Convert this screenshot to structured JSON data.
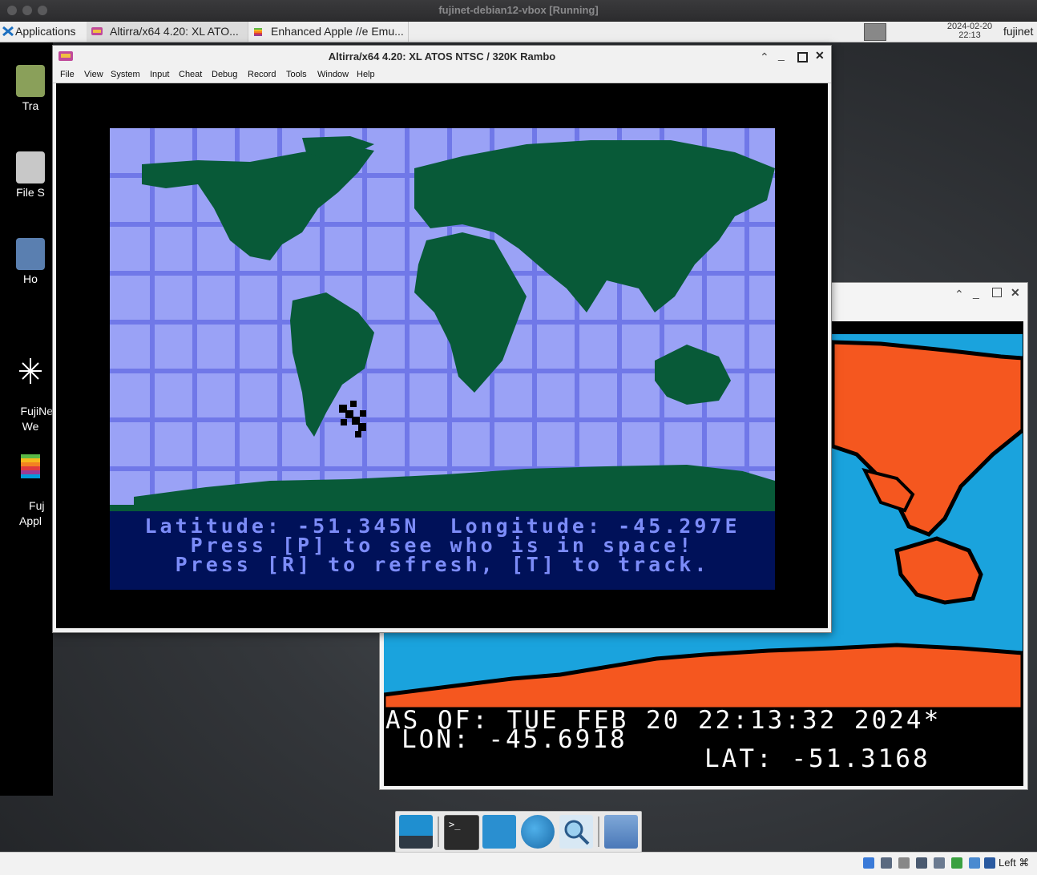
{
  "vbox": {
    "title": "fujinet-debian12-vbox [Running]"
  },
  "taskbar": {
    "applications_label": "Applications",
    "tabs": [
      {
        "label": "Altirra/x64 4.20: XL ATO..."
      },
      {
        "label": "Enhanced Apple //e Emu..."
      }
    ],
    "clock_date": "2024-02-20",
    "clock_time": "22:13",
    "user": "fujinet"
  },
  "desktop_icons": [
    {
      "label": "Tra"
    },
    {
      "label": "File S"
    },
    {
      "label": "Ho"
    },
    {
      "label": "FujiNe\nWe"
    },
    {
      "label": "Fuj\nAppl"
    }
  ],
  "atari": {
    "title": "Altirra/x64 4.20: XL ATOS NTSC / 320K Rambo",
    "menu": [
      "File",
      "View",
      "System",
      "Input",
      "Cheat",
      "Debug",
      "Record",
      "Tools",
      "Window",
      "Help"
    ],
    "line1": "Latitude: -51.345N  Longitude: -45.297E",
    "line2": "Press [P] to see who is in space!",
    "line3": "Press [R] to refresh, [T] to track."
  },
  "apple": {
    "line1": "AS OF: TUE FEB 20 22:13:32 2024*",
    "line2": "LON: -45.6918",
    "line3": "LAT: -51.3168"
  },
  "bottom_bar": {
    "host_key": "Left ⌘"
  },
  "colors": {
    "atari_ocean": "#9aa2f6",
    "atari_grid": "#7078e8",
    "atari_land": "#085a38",
    "atari_panel": "#001159",
    "atari_text": "#7c8cf8",
    "apple_ocean": "#1aa3dd",
    "apple_land": "#f5571f"
  }
}
